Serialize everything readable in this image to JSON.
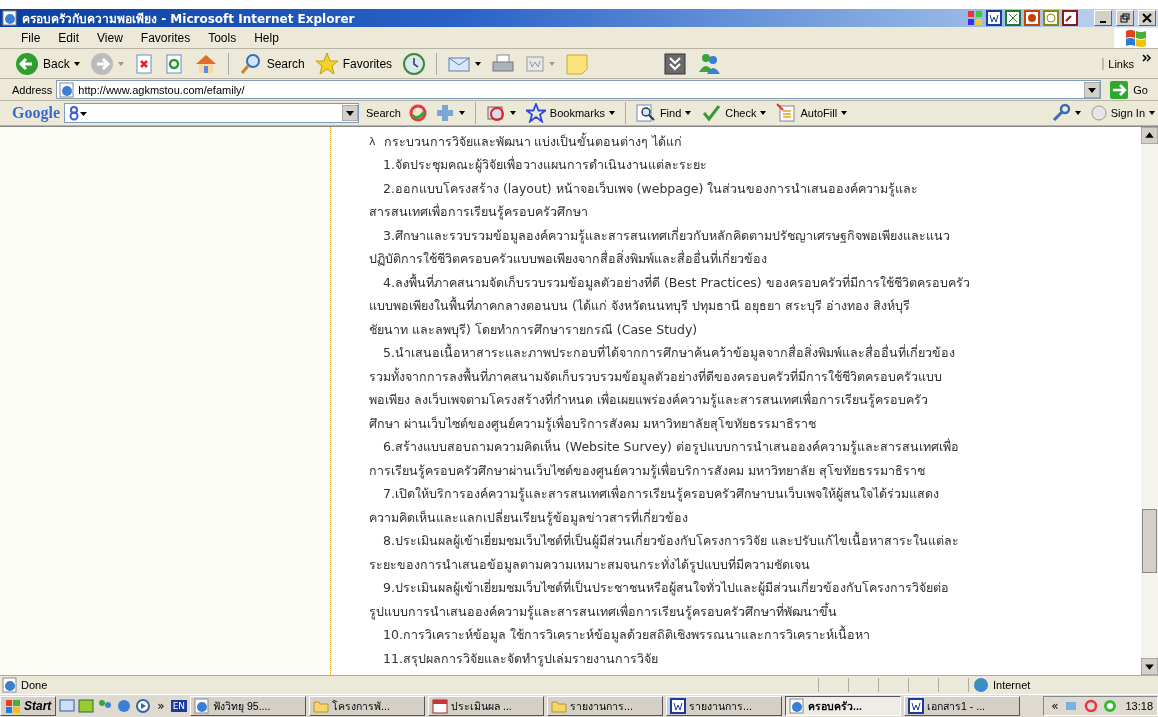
{
  "window": {
    "title": "ครอบครัวกับความพอเพียง - Microsoft Internet Explorer"
  },
  "menu": [
    "File",
    "Edit",
    "View",
    "Favorites",
    "Tools",
    "Help"
  ],
  "toolbar": {
    "back": "Back",
    "search": "Search",
    "favorites": "Favorites",
    "links": "Links"
  },
  "address": {
    "label": "Address",
    "url": "http://www.agkmstou.com/efamily/",
    "go": "Go"
  },
  "google_toolbar": {
    "logo": "Google",
    "search": "Search",
    "bookmarks": "Bookmarks",
    "find": "Find",
    "check": "Check",
    "autofill": "AutoFill",
    "sign_in": "Sign In"
  },
  "content": {
    "bullet": "λ",
    "lines": [
      {
        "kind": "head",
        "text": "กระบวนการวิจัยและพัฒนา แบ่งเป็นขั้นตอนต่างๆ ได้แก่"
      },
      {
        "kind": "item",
        "text": "1.จัดประชุมคณะผู้วิจัยเพื่อวางแผนการดำเนินงานแต่ละระยะ"
      },
      {
        "kind": "item",
        "text": "2.ออกแบบโครงสร้าง (layout) หน้าจอเว็บเพจ (webpage) ในส่วนของการนำเสนอองค์ความรู้และ"
      },
      {
        "kind": "cont",
        "text": "สารสนเทศเพื่อการเรียนรู้ครอบครัวศึกษา"
      },
      {
        "kind": "item",
        "text": "3.ศึกษาและรวบรวมข้อมูลองค์ความรู้และสารสนเทศเกี่ยวกับหลักคิดตามปรัชญาเศรษฐกิจพอเพียงและแนว"
      },
      {
        "kind": "cont",
        "text": "ปฏิบัติการใช้ชีวิตครอบครัวแบบพอเพียงจากสื่อสิ่งพิมพ์และสื่ออื่นที่เกี่ยวข้อง"
      },
      {
        "kind": "item",
        "text": "4.ลงพื้นที่ภาคสนามจัดเก็บรวบรวมข้อมูลตัวอย่างที่ดี (Best Practices) ของครอบครัวที่มีการใช้ชีวิตครอบครัว"
      },
      {
        "kind": "cont",
        "text": "แบบพอเพียงในพื้นที่ภาคกลางตอนบน (ได้แก่ จังหวัดนนทบุรี ปทุมธานี อยุธยา สระบุรี อ่างทอง สิงห์บุรี"
      },
      {
        "kind": "cont",
        "text": "ชัยนาท และลพบุรี) โดยทำการศึกษารายกรณี (Case Study)"
      },
      {
        "kind": "item",
        "text": "5.นำเสนอเนื้อหาสาระและภาพประกอบที่ได้จากการศึกษาค้นคว้าข้อมูลจากสื่อสิ่งพิมพ์และสื่ออื่นที่เกี่ยวข้อง"
      },
      {
        "kind": "cont",
        "text": "รวมทั้งจากการลงพื้นที่ภาคสนามจัดเก็บรวบรวมข้อมูลตัวอย่างที่ดีของครอบครัวที่มีการใช้ชีวิตครอบครัวแบบ"
      },
      {
        "kind": "cont",
        "text": "พอเพียง ลงเว็บเพจตามโครงสร้างที่กำหนด เพื่อเผยแพร่องค์ความรู้และสารสนเทศเพื่อการเรียนรู้ครอบครัว"
      },
      {
        "kind": "cont",
        "text": "ศึกษา ผ่านเว็บไซต์ของศูนย์ความรู้เพื่อบริการสังคม มหาวิทยาลัยสุโขทัยธรรมาธิราช"
      },
      {
        "kind": "item",
        "text": "6.สร้างแบบสอบถามความคิดเห็น (Website Survey) ต่อรูปแบบการนำเสนอองค์ความรู้และสารสนเทศเพื่อ"
      },
      {
        "kind": "cont",
        "text": "การเรียนรู้ครอบครัวศึกษาผ่านเว็บไซต์ของศูนย์ความรู้เพื่อบริการสังคม มหาวิทยาลัย สุโขทัยธรรมาธิราช"
      },
      {
        "kind": "item",
        "text": "7.เปิดให้บริการองค์ความรู้และสารสนเทศเพื่อการเรียนรู้ครอบครัวศึกษาบนเว็บเพจให้ผู้สนใจได้ร่วมแสดง"
      },
      {
        "kind": "cont",
        "text": "ความคิดเห็นและแลกเปลี่ยนเรียนรู้ข้อมูลข่าวสารที่เกี่ยวข้อง"
      },
      {
        "kind": "item",
        "text": "8.ประเมินผลผู้เข้าเยี่ยมชมเว็บไซต์ที่เป็นผู้มีส่วนเกี่ยวข้องกับโครงการวิจัย และปรับแก้ไขเนื้อหาสาระในแต่ละ"
      },
      {
        "kind": "cont",
        "text": "ระยะของการนำเสนอข้อมูลตามความเหมาะสมจนกระทั่งได้รูปแบบที่มีความชัดเจน"
      },
      {
        "kind": "item",
        "text": "9.ประเมินผลผู้เข้าเยี่ยมชมเว็บไซต์ที่เป็นประชาชนหรือผู้สนใจทั่วไปและผู้มีส่วนเกี่ยวข้องกับโครงการวิจัยต่อ"
      },
      {
        "kind": "cont",
        "text": "รูปแบบการนำเสนอองค์ความรู้และสารสนเทศเพื่อการเรียนรู้ครอบครัวศึกษาที่พัฒนาขึ้น"
      },
      {
        "kind": "item",
        "text": "10.การวิเคราะห์ข้อมูล ใช้การวิเคราะห์ข้อมูลด้วยสถิติเชิงพรรณนาและการวิเคราะห์เนื้อหา"
      },
      {
        "kind": "item",
        "text": "11.สรุปผลการวิจัยและจัดทำรูปเล่มรายงานการวิจัย"
      }
    ]
  },
  "status_bar": {
    "text": "Done",
    "zone": "Internet"
  },
  "taskbar": {
    "start": "Start",
    "more": "»",
    "language": "EN",
    "tasks": [
      {
        "label": "ฟังวิทยุ 95....",
        "kind": "browser",
        "selected": false
      },
      {
        "label": "โครงการพั...",
        "kind": "folder",
        "selected": false
      },
      {
        "label": "ประเมินผล ...",
        "kind": "calendar",
        "selected": false
      },
      {
        "label": "รายงานการ...",
        "kind": "folder",
        "selected": false
      },
      {
        "label": "รายงานการ...",
        "kind": "word",
        "selected": false
      },
      {
        "label": "ครอบครัว...",
        "kind": "browser",
        "selected": true
      },
      {
        "label": "เอกสาร1 - ...",
        "kind": "word",
        "selected": false
      }
    ],
    "tray_toggle": "«",
    "clock": "13:18"
  }
}
